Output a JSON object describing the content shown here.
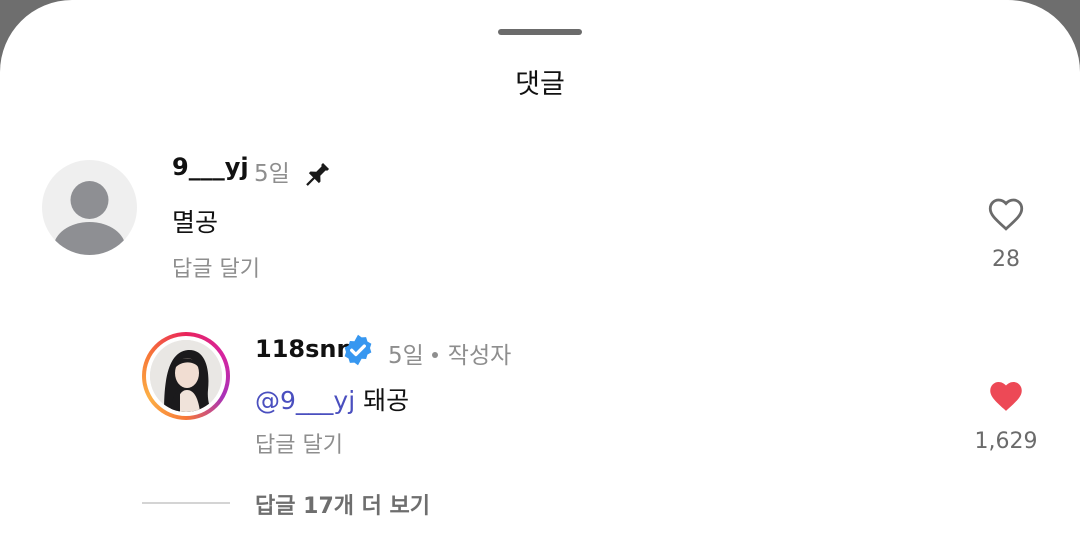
{
  "sheet": {
    "title": "댓글"
  },
  "comments": [
    {
      "username": "9___yj",
      "time": "5일",
      "text": "멸공",
      "reply_label": "답글 달기",
      "like_count": "28",
      "pinned": true,
      "liked": false
    }
  ],
  "reply": {
    "username": "118snn",
    "verified": true,
    "time": "5일",
    "author_badge": "작성자",
    "mention": "@9___yj",
    "text": "돼공",
    "reply_label": "답글 달기",
    "like_count": "1,629",
    "liked": true
  },
  "view_more_label": "답글 17개 더 보기",
  "colors": {
    "like_red": "#ed4956",
    "verified_blue": "#3797f0",
    "mention_blue": "#4a4fbf",
    "muted_text": "#8e8e8e"
  }
}
